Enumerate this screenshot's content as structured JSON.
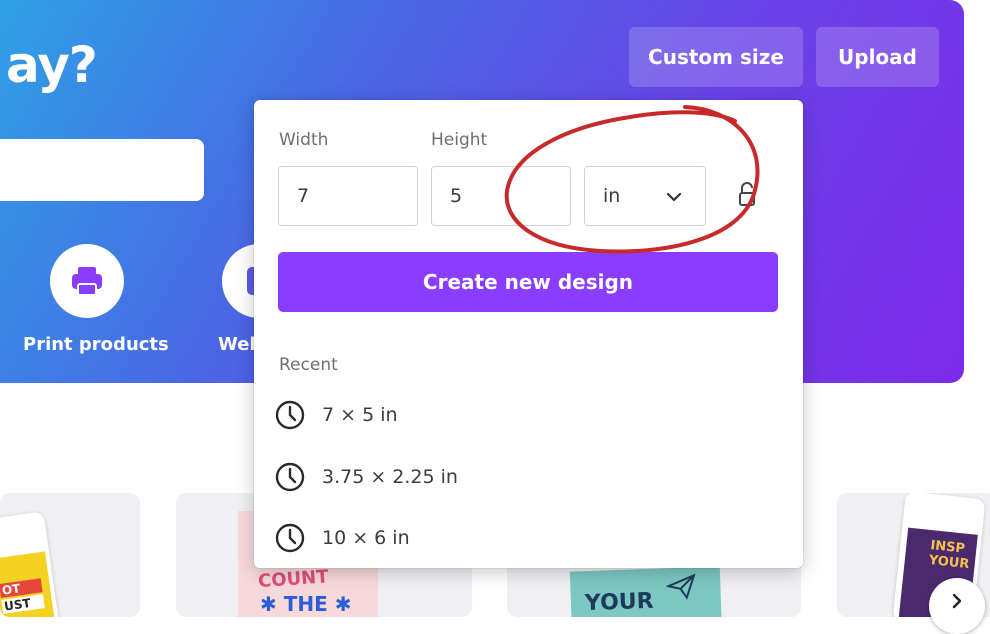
{
  "hero": {
    "title_fragment": "ay?",
    "categories": [
      {
        "label": "Print products",
        "icon": "printer-icon"
      },
      {
        "label": "Web",
        "icon": "web-icon"
      }
    ]
  },
  "header_buttons": {
    "custom_size": "Custom size",
    "upload": "Upload"
  },
  "custom_size_popup": {
    "width_label": "Width",
    "height_label": "Height",
    "width_value": "7",
    "height_value": "5",
    "unit": "in",
    "create_button": "Create new design",
    "recent_label": "Recent",
    "recent": [
      {
        "label": "7 × 5 in",
        "icon": "clock-icon"
      },
      {
        "label": "3.75 × 2.25 in",
        "icon": "clock-icon"
      },
      {
        "label": "10 × 6 in",
        "icon": "clock-icon"
      }
    ]
  },
  "templates": {
    "card_texts": [
      "OT",
      "UST",
      "COUNT",
      "THE",
      "YOUR",
      "INSP",
      "YOUR"
    ]
  },
  "colors": {
    "accent": "#8b3dff",
    "annotation_circle": "#c82a2a",
    "hero_gradient_start": "#2fa0e6",
    "hero_gradient_end": "#7c2ae8"
  }
}
